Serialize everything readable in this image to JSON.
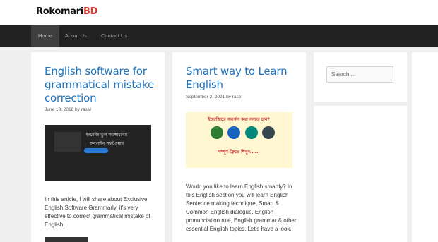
{
  "site": {
    "logo_main": "Rokomari",
    "logo_accent": "BD"
  },
  "nav": {
    "items": [
      "Home",
      "About Us",
      "Contact Us"
    ]
  },
  "posts": [
    {
      "title": "English software for grammatical mistake correction",
      "date": "June 13, 2018",
      "by": "by",
      "author": "rasel",
      "banner_line1": "ইংরেজি ভুল সংশোধনের",
      "banner_line2": "অনলাইন সফটওয়ার",
      "excerpt": "In this article, I will share about Exclusive English Software Grammarly. it's very effective to correct grammatical mistake of English."
    },
    {
      "title": "Smart way to Learn English",
      "date": "September 2, 2021",
      "by": "by",
      "author": "rasel",
      "banner_line1": "ইংরেজিতে অনর্গল কথা বলতে চান?",
      "banner_line2": "সম্পূর্ণ ফ্রিতে শিখুন......",
      "excerpt": "Would you like to learn English smartly? In this English section you will learn English Sentence making technique, Smart & Common English dialogue. English pronunciation rule, English grammar & other essential English topics. Let's have a look."
    }
  ],
  "sidebar": {
    "search_placeholder": "Search ..."
  },
  "colors": {
    "link": "#1e73be",
    "nav_bg": "#222222",
    "page_bg": "#efefef",
    "logo_accent": "#e53935"
  }
}
